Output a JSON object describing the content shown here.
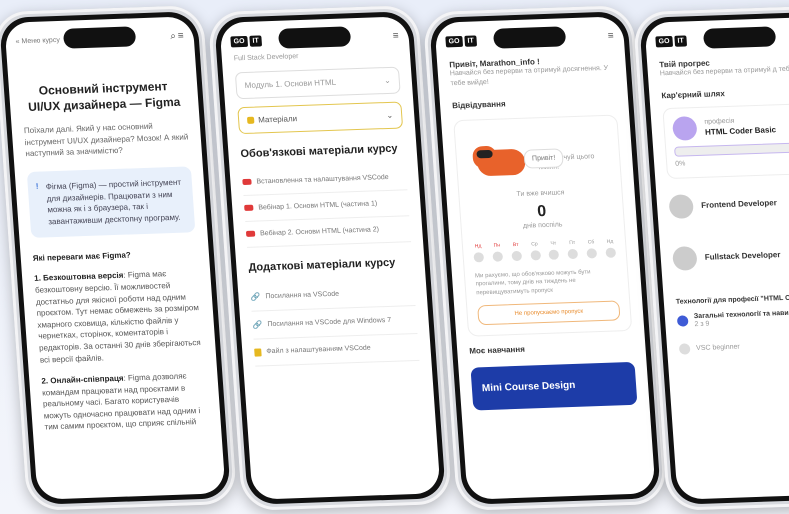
{
  "phone1": {
    "back_link": "« Меню курсу",
    "title": "Основний інструмент UI/UX дизайнера — Figma",
    "intro": "Поїхали далі. Який у нас основний інструмент UI/UX дизайнера? Мозок! А який наступний за значимістю?",
    "tip": "Фігма (Figma) — простий інструмент для дизайнерів. Працювати з ним можна як і з браузера, так і завантаживши десктопну програму.",
    "subtitle": "Які переваги має Figma?",
    "point1_title": "1. Безкоштовна версія",
    "point1_text": ": Figma має безкоштовну версію. Її можливостей достатньо для якісної роботи над одним проєктом. Тут немає обмежень за розміром хмарного сховища, кількістю файлів у чернетках, сторінок, коментаторів і редакторів. За останні 30 днів зберігаються всі версії файлів.",
    "point2_title": "2. Онлайн-співпраця",
    "point2_text": ": Figma дозволяє командам працювати над проєктами в реальному часі. Багато користувачів можуть одночасно працювати над одним і тим самим проєктом, що сприяє спільній"
  },
  "phone2": {
    "subtitle": "Full Stack Developer",
    "module_select": "Модуль 1. Основи HTML",
    "materials_select": "Матеріали",
    "required_heading": "Обов'язкові матеріали курсу",
    "required_items": [
      "Встановлення та налаштування VSCode",
      "Вебінар 1. Основи HTML (частина 1)",
      "Вебінар 2. Основи HTML (частина 2)"
    ],
    "extra_heading": "Додаткові матеріали курсу",
    "extra_items": [
      "Посилання на VSCode",
      "Посилання на VSCode для Windows 7",
      "Файл з налаштуванням VSCode"
    ]
  },
  "phone3": {
    "greeting": "Привіт, Marathon_info !",
    "greeting_sub": "Навчайся без перерви та отримуй досягнення. У тебе вийде!",
    "section": "Відвідування",
    "bubble": "Привіт!",
    "bubble_note": "Не закінчуй цього тижня!",
    "streak_label": "Ти вже вчишся",
    "streak_value": "0",
    "streak_unit": "днів поспіль",
    "days": [
      "Нд",
      "Пн",
      "Вт",
      "Ср",
      "Чт",
      "Пт",
      "Сб",
      "Нд"
    ],
    "note": "Ми рахуємо, що обов'язково можуть бути прогалини, тому днів на тиждень не перевищуватимуть пропуск",
    "button": "Не пропускаємо пропуск",
    "my_learning": "Моє навчання",
    "course_title": "Mini Course Design"
  },
  "phone4": {
    "progress_title": "Твій прогрес",
    "progress_sub": "Навчайся без перерви та отримуй д тебе вийде!",
    "career_title": "Кар'єрний шлях",
    "profession_label": "професія",
    "profession": "HTML Coder Basic",
    "progress_value": "0%",
    "step2": "Frontend Developer",
    "step3": "Fullstack Developer",
    "tech_title": "Технології для професії \"HTML Co",
    "tech1": "Загальні технології та нави",
    "tech1_count": "2 з 9",
    "tech2": "VSC beginner"
  }
}
